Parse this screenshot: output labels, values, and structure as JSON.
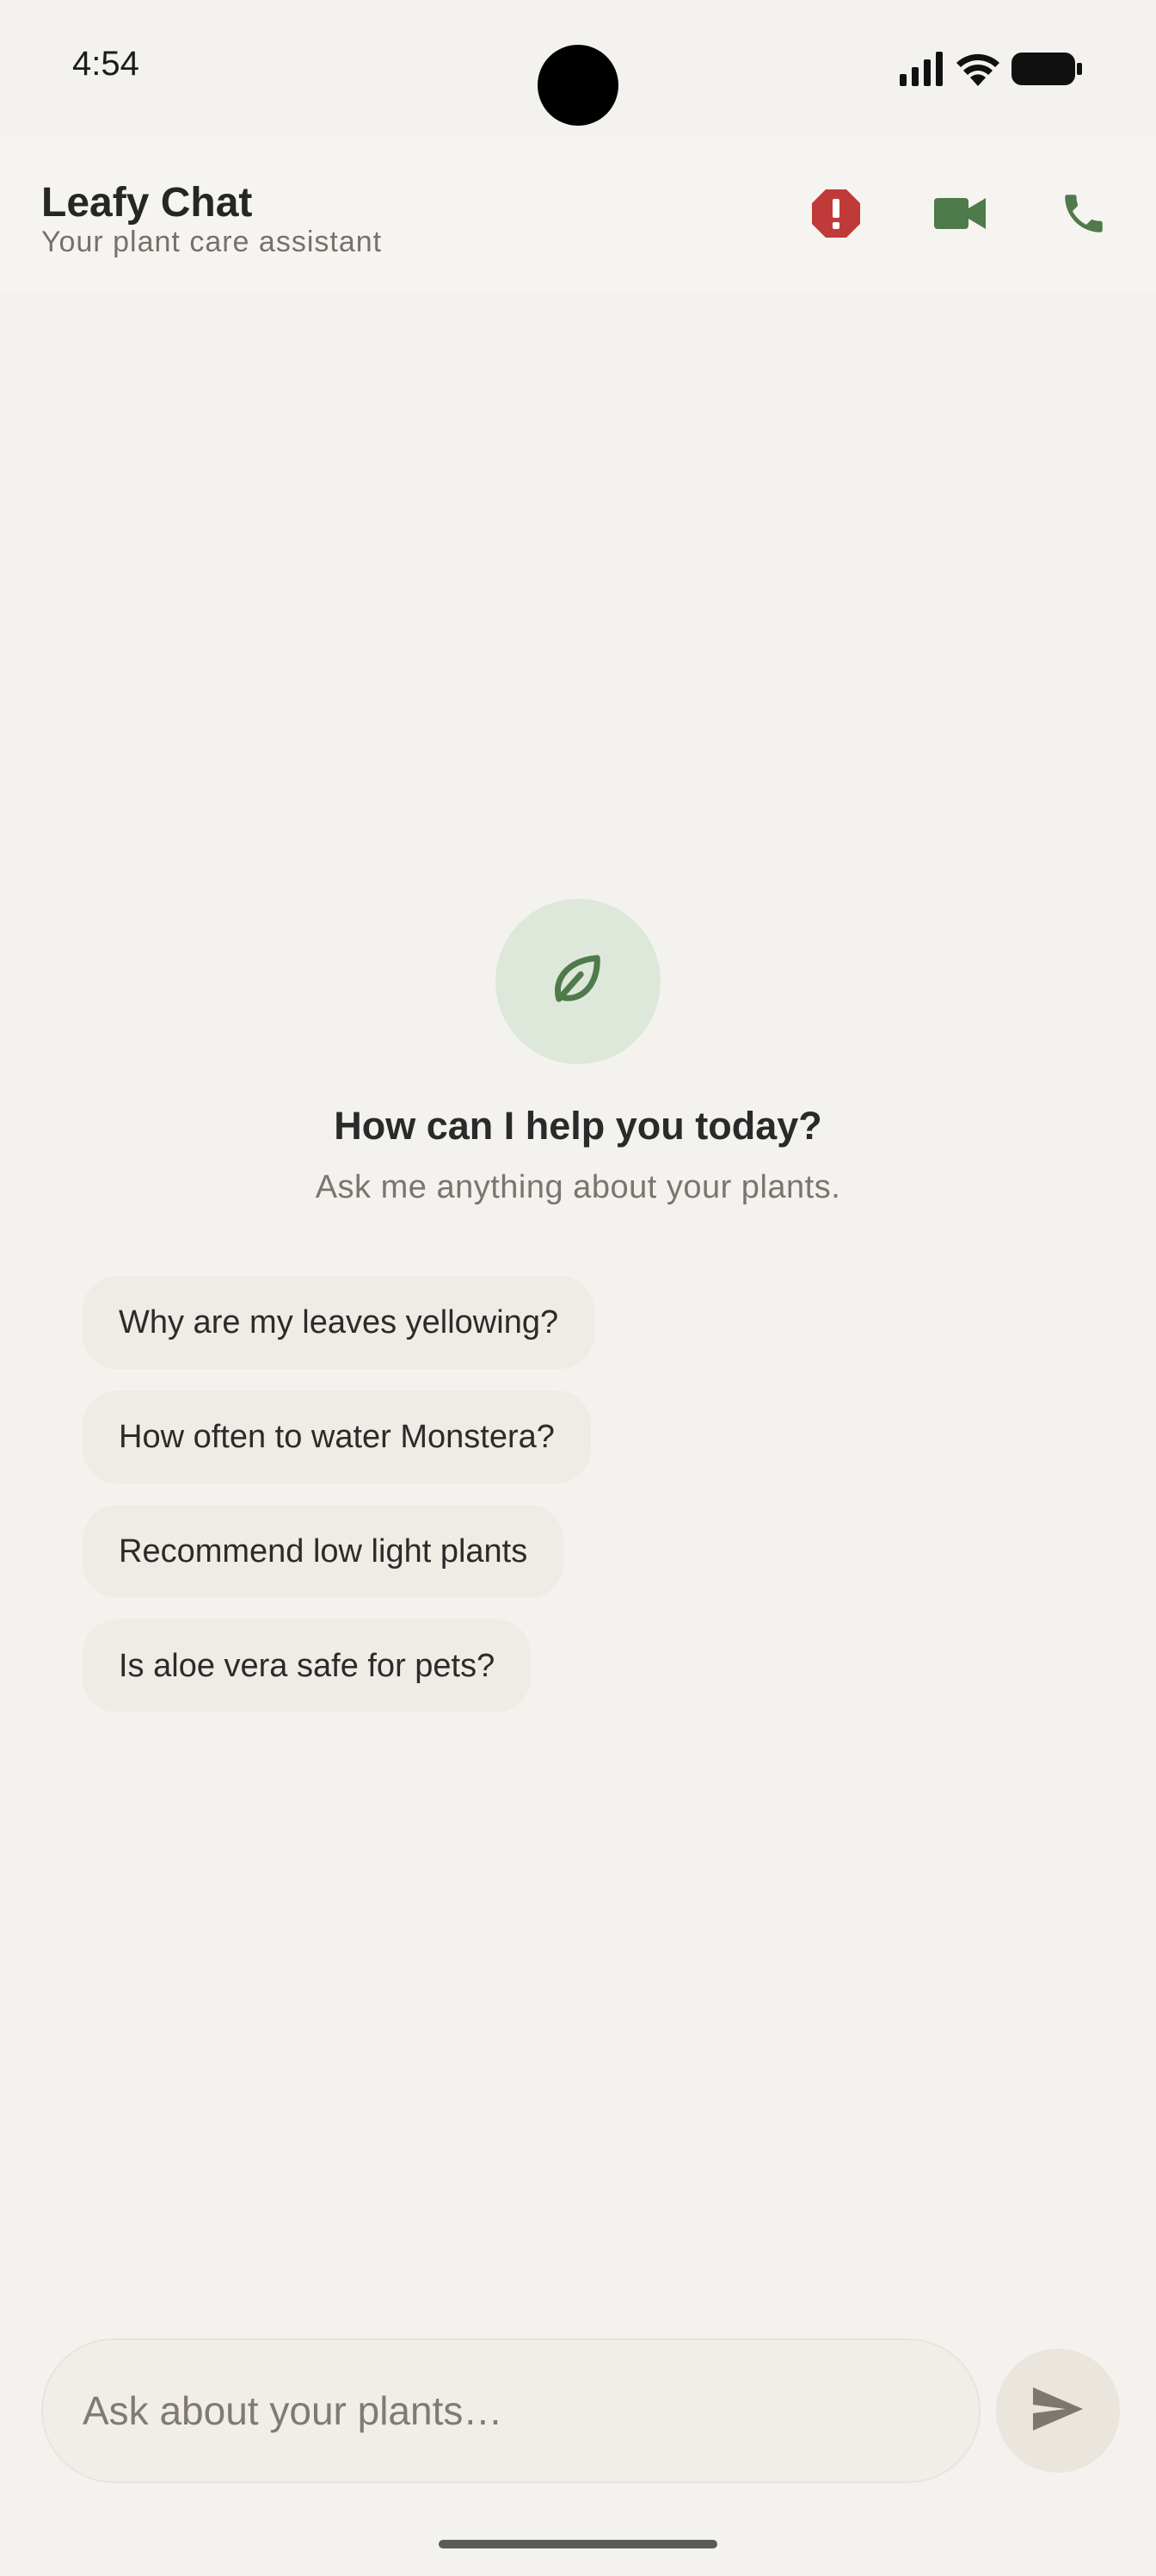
{
  "status_bar": {
    "time": "4:54",
    "icons": [
      "signal-icon",
      "wifi-icon",
      "battery-icon"
    ]
  },
  "header": {
    "title": "Leafy Chat",
    "subtitle": "Your plant care assistant",
    "actions": [
      {
        "name": "alert-icon",
        "color": "#c13a3a"
      },
      {
        "name": "video-call-icon",
        "color": "#4f7a4c"
      },
      {
        "name": "phone-call-icon",
        "color": "#4f7a4c"
      }
    ]
  },
  "empty_state": {
    "icon": "leaf-icon",
    "heading": "How can I help you today?",
    "subheading": "Ask me anything about your plants."
  },
  "suggestions": [
    "Why are my leaves yellowing?",
    "How often to water Monstera?",
    "Recommend low light plants",
    "Is aloe vera safe for pets?"
  ],
  "composer": {
    "placeholder": "Ask about your plants…",
    "send_icon": "send-icon"
  },
  "colors": {
    "background": "#f4f2ee",
    "accent_green": "#4f7a4c",
    "alert_red": "#c13a3a",
    "chip_bg": "#efebe5"
  }
}
